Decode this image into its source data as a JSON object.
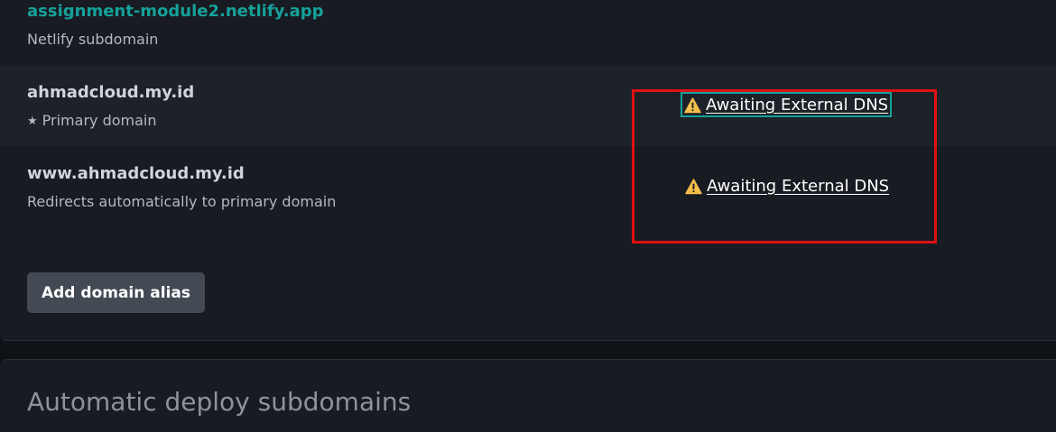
{
  "domains": [
    {
      "name": "assignment-module2.netlify.app",
      "subtitle": "Netlify subdomain",
      "status": ""
    },
    {
      "name": "ahmadcloud.my.id",
      "subtitle": "Primary domain",
      "status": "Awaiting External DNS",
      "icon": "star-icon"
    },
    {
      "name": "www.ahmadcloud.my.id",
      "subtitle": "Redirects automatically to primary domain",
      "status": "Awaiting External DNS"
    }
  ],
  "actions": {
    "add_alias_label": "Add domain alias"
  },
  "next_section": {
    "title": "Automatic deploy subdomains"
  },
  "colors": {
    "link": "#15a19a",
    "warning": "#f5c04a",
    "highlight": "#e01111",
    "button_bg": "#434a54"
  }
}
